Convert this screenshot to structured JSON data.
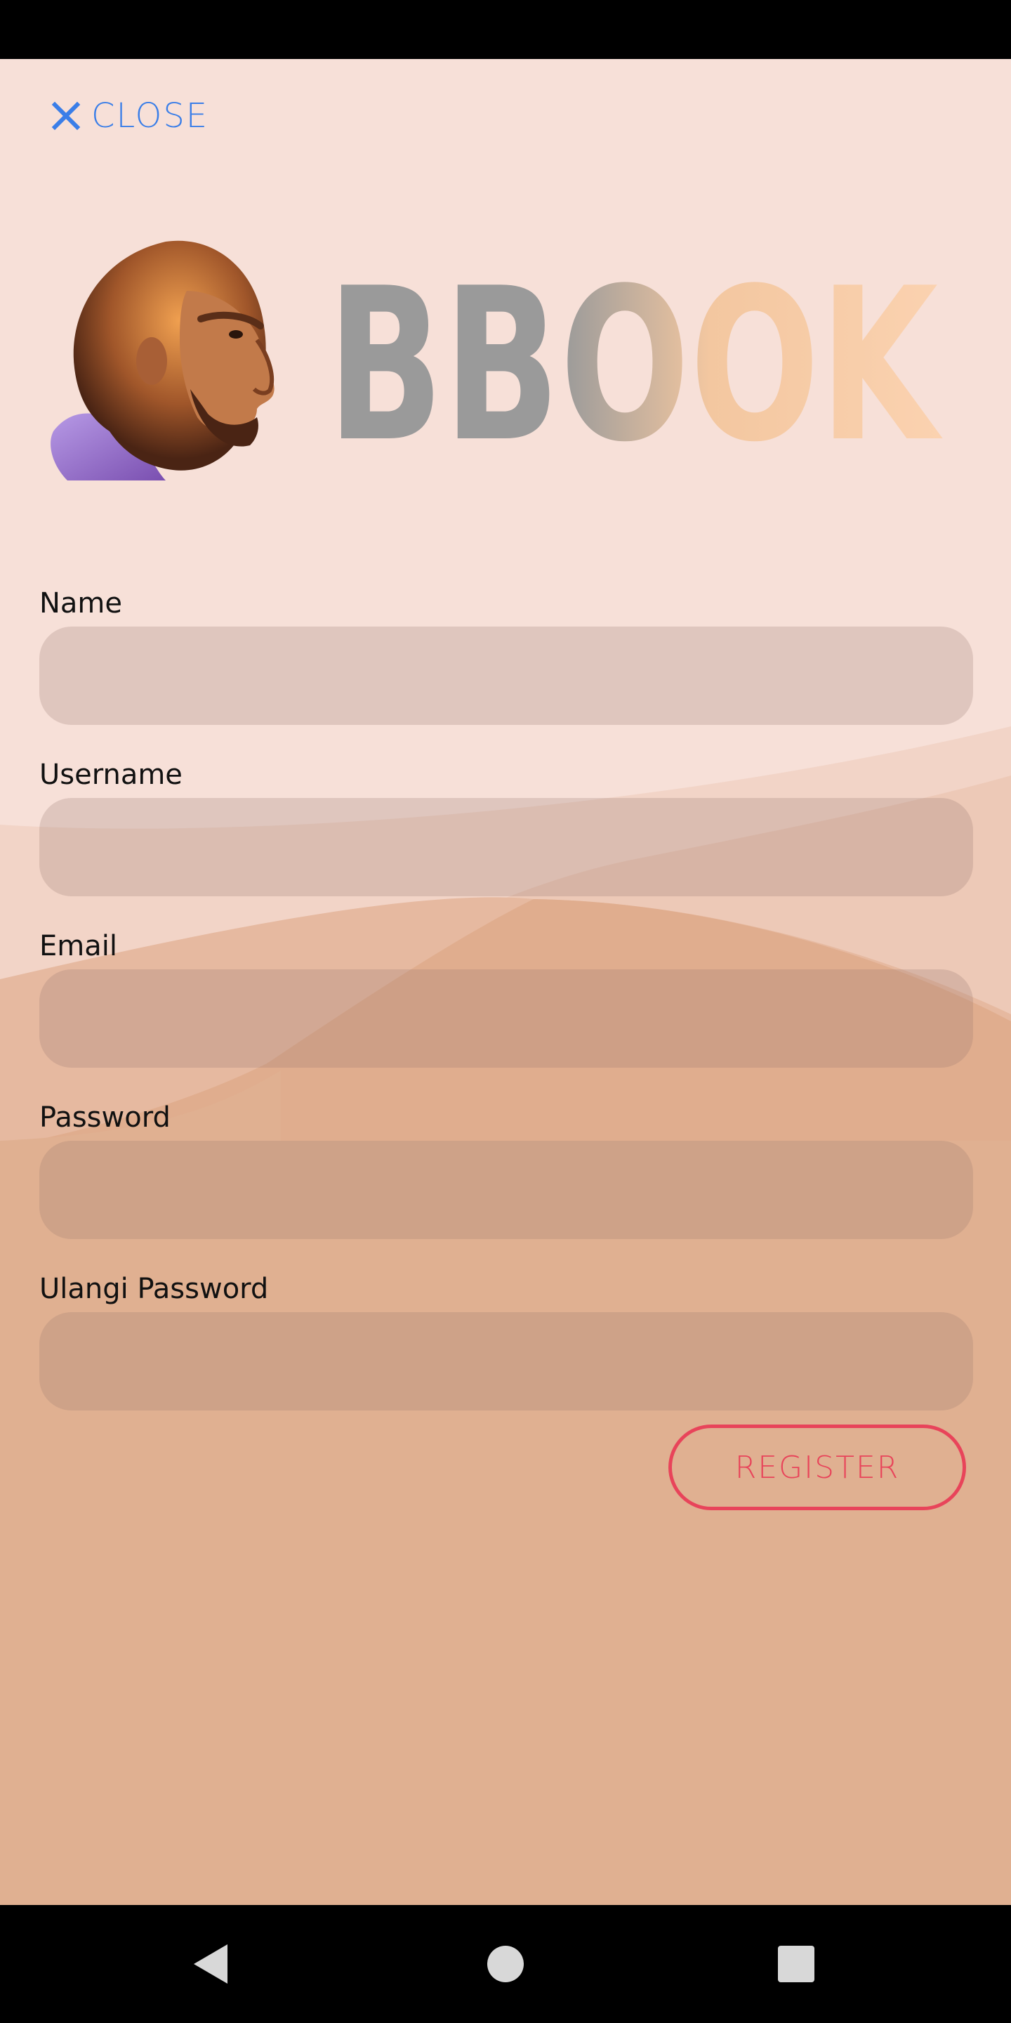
{
  "close": {
    "label": "CLOSE",
    "icon": "close-icon"
  },
  "logo": {
    "brand": "BBOOK",
    "mascot": "caveman-head-icon"
  },
  "form": {
    "fields": [
      {
        "label": "Name",
        "value": "",
        "placeholder": ""
      },
      {
        "label": "Username",
        "value": "",
        "placeholder": ""
      },
      {
        "label": "Email",
        "value": "",
        "placeholder": ""
      },
      {
        "label": "Password",
        "value": "",
        "placeholder": ""
      },
      {
        "label": "Ulangi Password",
        "value": "",
        "placeholder": ""
      }
    ],
    "submit_label": "REGISTER"
  },
  "navigation": {
    "back_icon": "back-triangle-icon",
    "home_icon": "home-circle-icon",
    "recents_icon": "recents-square-icon"
  },
  "colors": {
    "accent": "#3a7ee8",
    "register": "#e8445a",
    "background_top": "#f7e0d8",
    "background_bottom": "#e0b091"
  }
}
